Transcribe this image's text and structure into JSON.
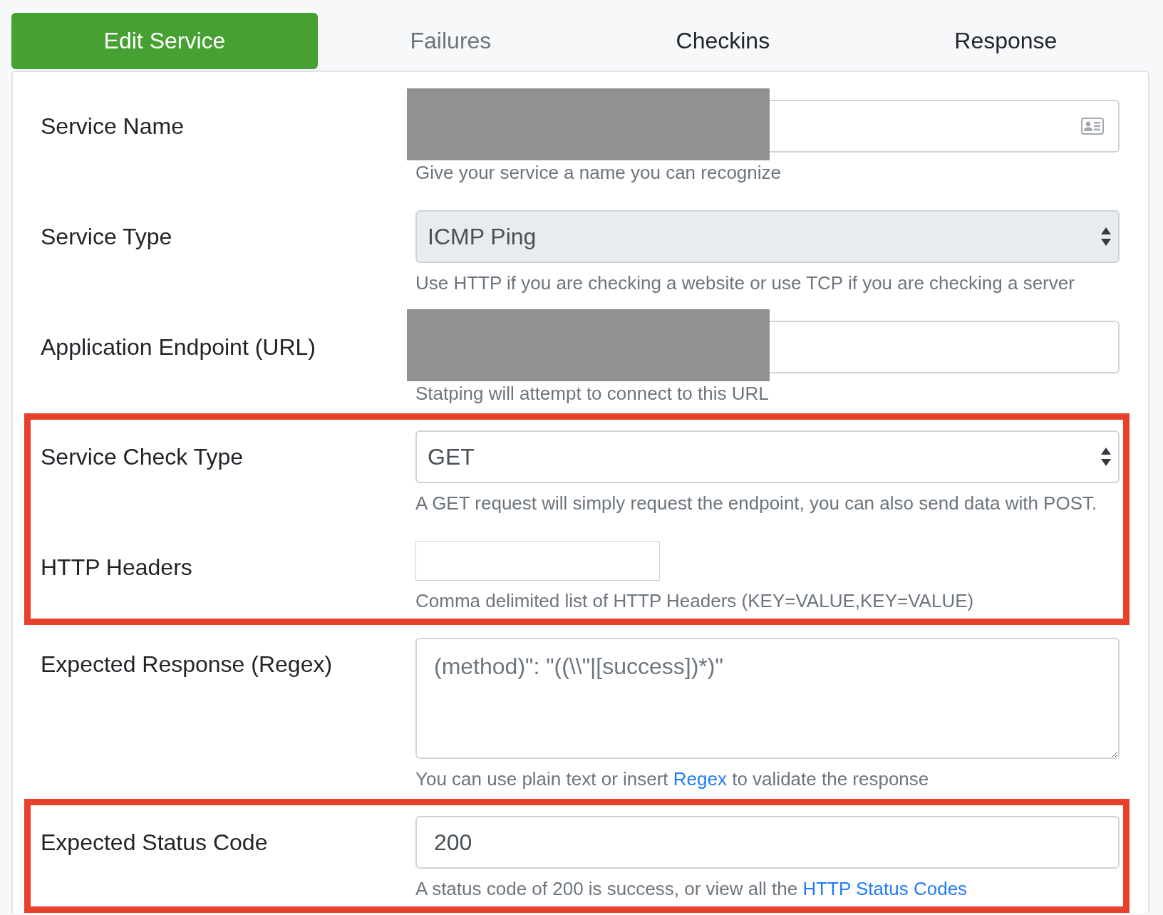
{
  "tabs": [
    {
      "label": "Edit Service",
      "selected": true,
      "disabled": false
    },
    {
      "label": "Failures",
      "selected": false,
      "disabled": true
    },
    {
      "label": "Checkins",
      "selected": false,
      "disabled": false
    },
    {
      "label": "Response",
      "selected": false,
      "disabled": false
    }
  ],
  "form": {
    "groups": [
      {
        "highlighted": false,
        "fields": [
          {
            "label": "Service Name",
            "kind": "icon-input",
            "redacted": true,
            "disabled": false,
            "help": [
              {
                "text": "Give your service a name you can recognize",
                "link": false
              }
            ]
          },
          {
            "label": "Service Type",
            "kind": "select",
            "value": "ICMP Ping",
            "redacted": false,
            "disabled": true,
            "help": [
              {
                "text": "Use HTTP if you are checking a website or use TCP if you are checking a server",
                "link": false
              }
            ]
          },
          {
            "label": "Application Endpoint (URL)",
            "kind": "input",
            "redacted": true,
            "disabled": false,
            "help": [
              {
                "text": "Statping will attempt to connect to this URL",
                "link": false
              }
            ]
          }
        ]
      },
      {
        "highlighted": true,
        "fields": [
          {
            "label": "Service Check Type",
            "kind": "select",
            "value": "GET",
            "redacted": false,
            "disabled": false,
            "help": [
              {
                "text": "A GET request will simply request the endpoint, you can also send data with POST.",
                "link": false
              }
            ]
          },
          {
            "label": "HTTP Headers",
            "kind": "short-input",
            "redacted": false,
            "disabled": false,
            "help": [
              {
                "text": "Comma delimited list of HTTP Headers (KEY=VALUE,KEY=VALUE)",
                "link": false
              }
            ]
          }
        ]
      },
      {
        "highlighted": false,
        "fields": [
          {
            "label": "Expected Response (Regex)",
            "kind": "textarea",
            "placeholder": "(method)\": \"((\\\\\"|[success])*)\"",
            "redacted": false,
            "disabled": false,
            "help": [
              {
                "text": "You can use plain text or insert ",
                "link": false
              },
              {
                "text": "Regex",
                "link": true
              },
              {
                "text": " to validate the response",
                "link": false
              }
            ]
          }
        ]
      },
      {
        "highlighted": true,
        "fields": [
          {
            "label": "Expected Status Code",
            "kind": "input",
            "value": "200",
            "redacted": false,
            "disabled": false,
            "help": [
              {
                "text": "A status code of 200 is success, or view all the ",
                "link": false
              },
              {
                "text": "HTTP Status Codes",
                "link": true
              }
            ]
          }
        ]
      }
    ]
  }
}
